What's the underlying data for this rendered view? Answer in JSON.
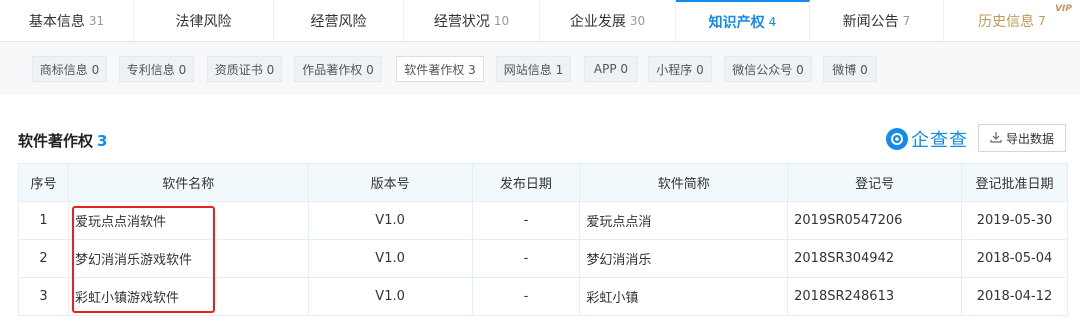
{
  "tabs": [
    {
      "label": "基本信息",
      "count": "31"
    },
    {
      "label": "法律风险",
      "count": ""
    },
    {
      "label": "经营风险",
      "count": ""
    },
    {
      "label": "经营状况",
      "count": "10"
    },
    {
      "label": "企业发展",
      "count": "30"
    },
    {
      "label": "知识产权",
      "count": "4",
      "active": true
    },
    {
      "label": "新闻公告",
      "count": "7"
    },
    {
      "label": "历史信息",
      "count": "7",
      "vip": "VIP"
    }
  ],
  "chips": [
    {
      "label": "商标信息 0"
    },
    {
      "label": "专利信息 0"
    },
    {
      "label": "资质证书 0"
    },
    {
      "label": "作品著作权 0"
    },
    {
      "label": "软件著作权 3"
    },
    {
      "label": "网站信息 1"
    },
    {
      "label": "APP 0"
    },
    {
      "label": "小程序 0"
    },
    {
      "label": "微信公众号 0"
    },
    {
      "label": "微博 0"
    }
  ],
  "section": {
    "title": "软件著作权",
    "count": "3"
  },
  "brand": {
    "name": "企查查"
  },
  "export": {
    "label": "导出数据"
  },
  "table": {
    "headers": [
      "序号",
      "软件名称",
      "版本号",
      "发布日期",
      "软件简称",
      "登记号",
      "登记批准日期"
    ],
    "rows": [
      [
        "1",
        "爱玩点点消软件",
        "V1.0",
        "-",
        "爱玩点点消",
        "2019SR0547206",
        "2019-05-30"
      ],
      [
        "2",
        "梦幻消消乐游戏软件",
        "V1.0",
        "-",
        "梦幻消消乐",
        "2018SR304942",
        "2018-05-04"
      ],
      [
        "3",
        "彩虹小镇游戏软件",
        "V1.0",
        "-",
        "彩虹小镇",
        "2018SR248613",
        "2018-04-12"
      ]
    ]
  },
  "colors": {
    "accent": "#128bed",
    "vip": "#c4965a",
    "highlight": "#e8231c"
  },
  "icons": {
    "brand": "brand-logo-icon",
    "export": "download-icon"
  }
}
